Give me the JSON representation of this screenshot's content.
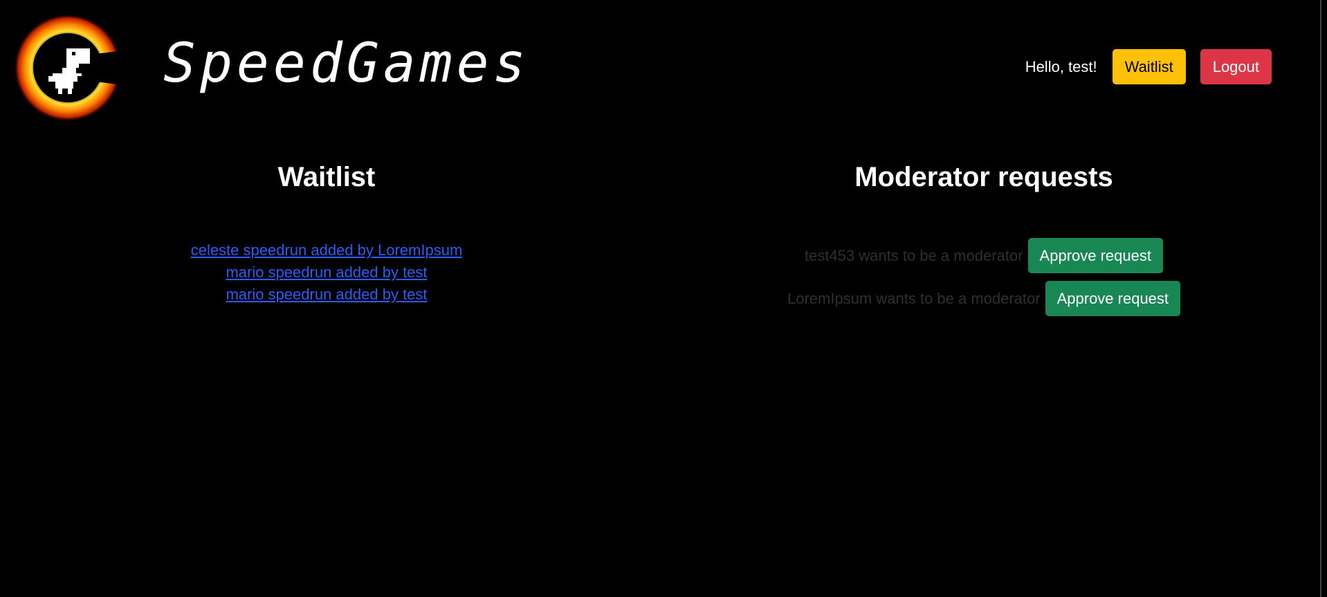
{
  "header": {
    "brand": "SpeedGames",
    "logo_icon": "flaming-dino-logo-icon",
    "greeting": "Hello, test!",
    "waitlist_label": "Waitlist",
    "logout_label": "Logout"
  },
  "waitlist": {
    "title": "Waitlist",
    "items": [
      {
        "label": "celeste speedrun added by LoremIpsum"
      },
      {
        "label": "mario speedrun added by test"
      },
      {
        "label": "mario speedrun added by test"
      }
    ]
  },
  "moderator": {
    "title": "Moderator requests",
    "requests": [
      {
        "text": "test453 wants to be a moderator",
        "button": "Approve request"
      },
      {
        "text": "LoremIpsum wants to be a moderator",
        "button": "Approve request"
      }
    ]
  },
  "colors": {
    "background": "#000000",
    "waitlist_button": "#ffc107",
    "logout_button": "#dc3545",
    "approve_button": "#198754",
    "link": "#2b5cf5"
  }
}
